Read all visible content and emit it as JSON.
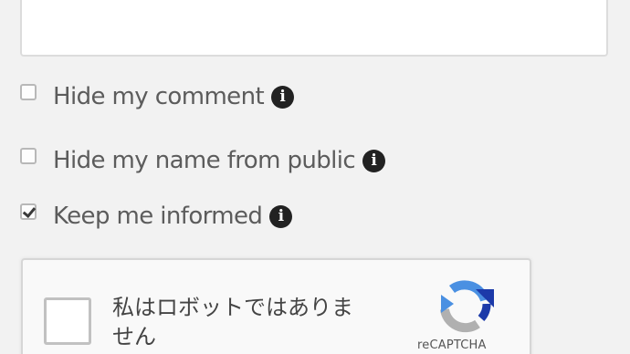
{
  "form": {
    "options": [
      {
        "label": "Hide my comment",
        "checked": false
      },
      {
        "label": "Hide my name from public",
        "checked": false
      },
      {
        "label": "Keep me informed",
        "checked": true
      }
    ],
    "info_icon_glyph": "i"
  },
  "recaptcha": {
    "label": "私はロボットではありません",
    "brand": "reCAPTCHA",
    "logo_colors": {
      "blue": "#1c3aa9",
      "light_blue": "#4a90e2",
      "gray": "#b0b0b0"
    }
  }
}
